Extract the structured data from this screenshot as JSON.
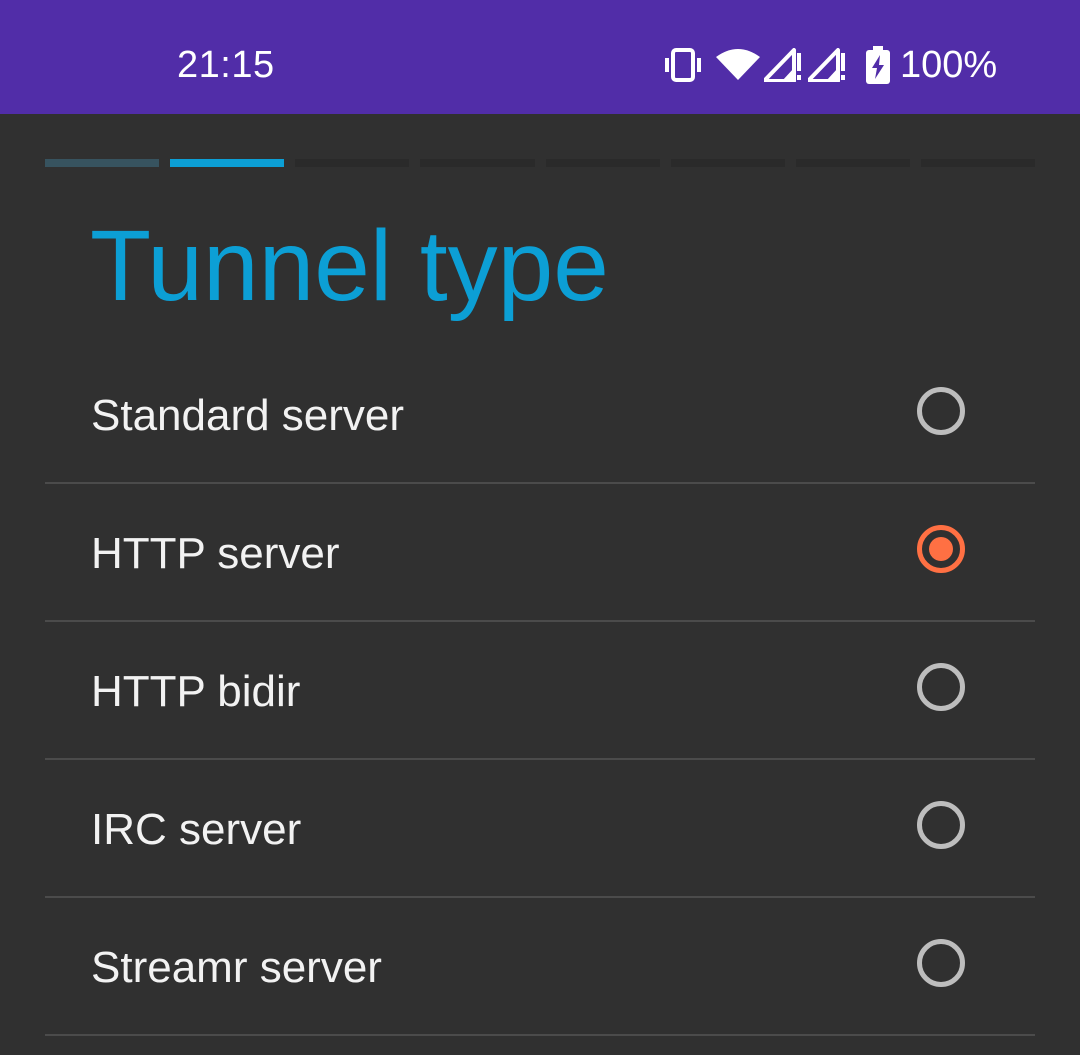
{
  "status_bar": {
    "time": "21:15",
    "battery": "100%",
    "icons": [
      "vibrate-icon",
      "wifi-icon",
      "signal-no-service-icon",
      "signal-no-service-icon",
      "battery-charging-icon"
    ],
    "background": "#512DA8"
  },
  "wizard": {
    "step_count": 8,
    "current_step": 2,
    "title": "Tunnel type",
    "accent_color": "#0C9FD5"
  },
  "tunnel_types": [
    {
      "label": "Standard server",
      "selected": false
    },
    {
      "label": "HTTP server",
      "selected": true
    },
    {
      "label": "HTTP bidir",
      "selected": false
    },
    {
      "label": "IRC server",
      "selected": false
    },
    {
      "label": "Streamr server",
      "selected": false
    }
  ],
  "radio_selected_color": "#FF7043"
}
